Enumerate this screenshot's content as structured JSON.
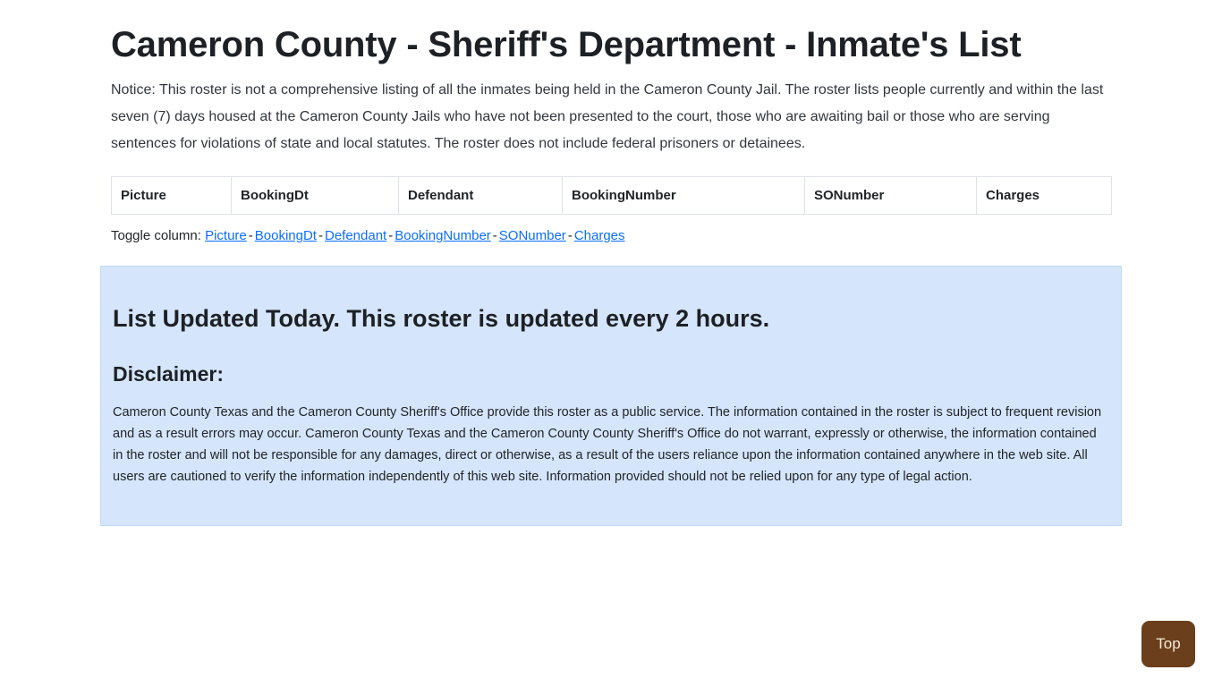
{
  "page": {
    "title": "Cameron County - Sheriff's Department - Inmate's List",
    "notice": "Notice: This roster is not a comprehensive listing of all the inmates being held in the Cameron County Jail. The roster lists people currently and within the last seven (7) days housed at the Cameron County Jails who have not been presented to the court, those who are awaiting bail or those who are serving sentences for violations of state and local statutes. The roster does not include federal prisoners or detainees."
  },
  "table": {
    "columns": [
      {
        "key": "picture",
        "label": "Picture"
      },
      {
        "key": "bookingdt",
        "label": "BookingDt"
      },
      {
        "key": "defendant",
        "label": "Defendant"
      },
      {
        "key": "bookingnumber",
        "label": "BookingNumber"
      },
      {
        "key": "sonumber",
        "label": "SONumber"
      },
      {
        "key": "charges",
        "label": "Charges"
      }
    ],
    "rows": []
  },
  "toggle": {
    "label": "Toggle column:",
    "separator": "-",
    "links": [
      {
        "label": "Picture"
      },
      {
        "label": "BookingDt"
      },
      {
        "label": "Defendant"
      },
      {
        "label": "BookingNumber"
      },
      {
        "label": "SONumber"
      },
      {
        "label": "Charges"
      }
    ]
  },
  "alert": {
    "heading": "List Updated Today. This roster is updated every 2 hours.",
    "subheading": "Disclaimer:",
    "body": "Cameron County Texas and the Cameron County Sheriff's Office provide this roster as a public service. The information contained in the roster is subject to frequent revision and as a result errors may occur. Cameron County Texas and the Cameron County County Sheriff's Office do not warrant, expressly or otherwise, the information contained in the roster and will not be responsible for any damages, direct or otherwise, as a result of the users reliance upon the information contained anywhere in the web site. All users are cautioned to verify the information independently of this web site. Information provided should not be relied upon for any type of legal action.",
    "background_color": "#d5e5fb"
  },
  "top_button": {
    "label": "Top",
    "background_color": "#6b3f1c",
    "text_color": "#f6e9d8"
  }
}
